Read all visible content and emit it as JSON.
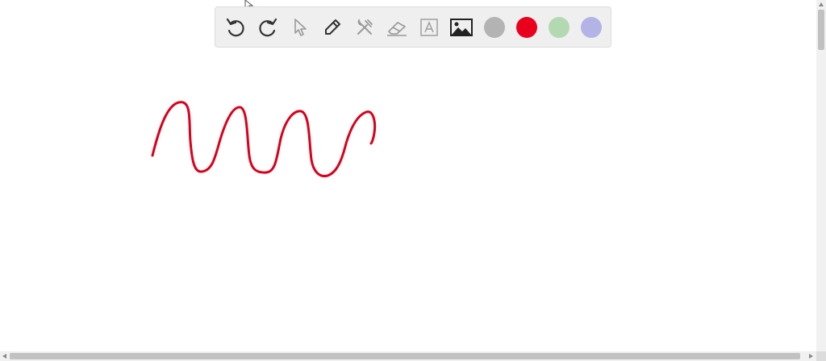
{
  "toolbar": {
    "tools": [
      {
        "name": "undo-icon",
        "enabled": true
      },
      {
        "name": "redo-icon",
        "enabled": true
      },
      {
        "name": "select-pointer-icon",
        "enabled": false
      },
      {
        "name": "pen-icon",
        "enabled": true
      },
      {
        "name": "tools-icon",
        "enabled": false
      },
      {
        "name": "eraser-icon",
        "enabled": false
      },
      {
        "name": "text-tool-icon",
        "enabled": false
      },
      {
        "name": "image-icon",
        "enabled": true
      }
    ],
    "swatches": [
      {
        "name": "gray",
        "color": "#b3b3b3"
      },
      {
        "name": "red",
        "color": "#e8001c"
      },
      {
        "name": "green",
        "color": "#b3d9b3"
      },
      {
        "name": "lavender",
        "color": "#b3b3e6"
      }
    ],
    "selected_swatch": "red"
  },
  "drawing": {
    "stroke_color": "#d9001b"
  },
  "colors": {
    "toolbar_bg": "#efefef",
    "icon_active": "#333333",
    "icon_disabled": "#9a9a9a"
  }
}
